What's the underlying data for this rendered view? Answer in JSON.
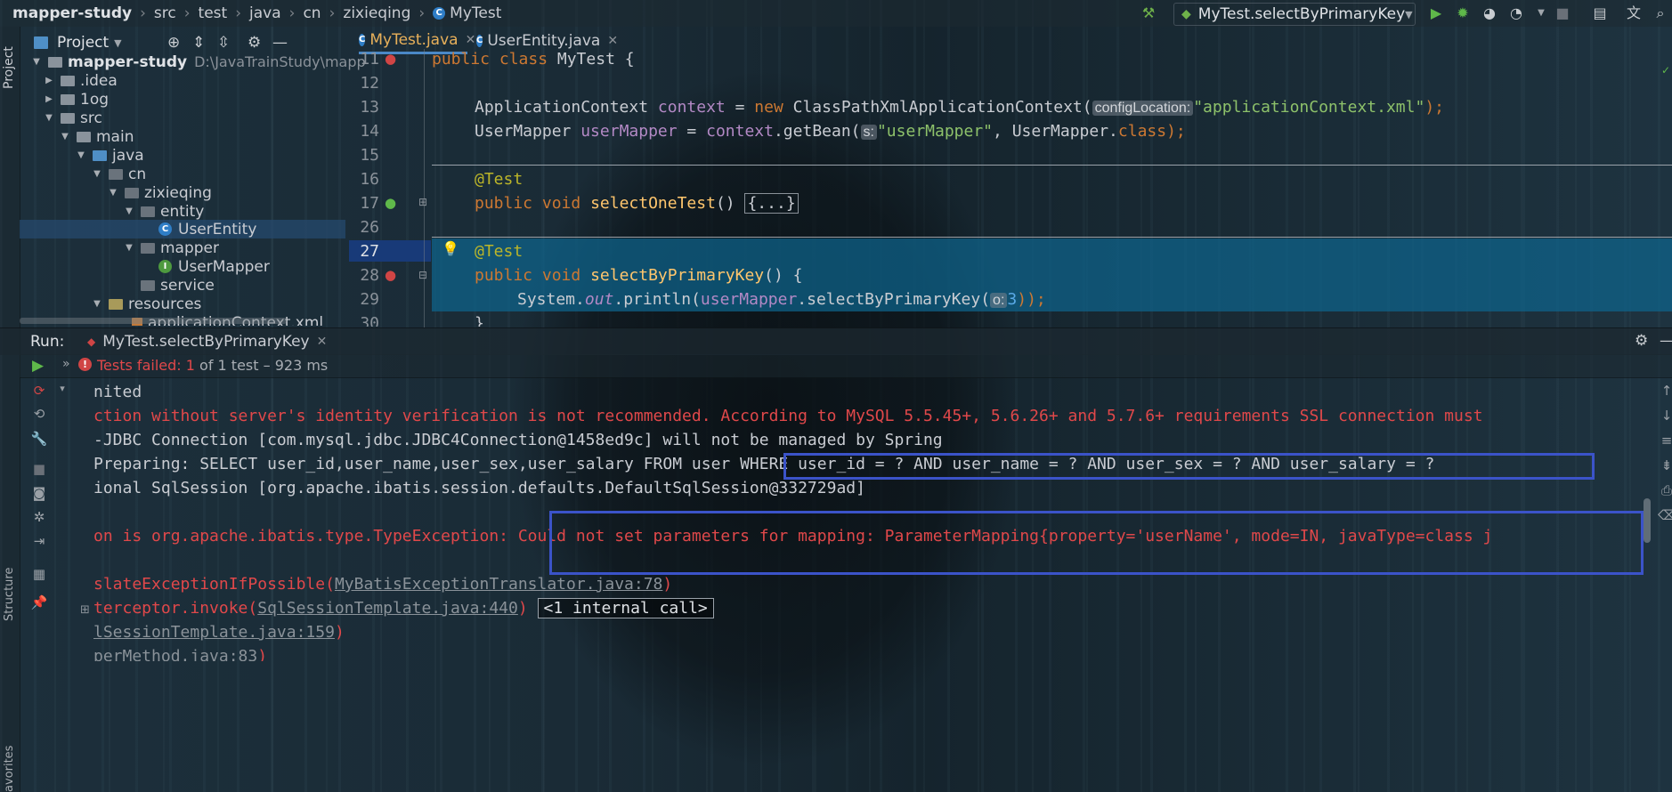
{
  "breadcrumbs": [
    "mapper-study",
    "src",
    "test",
    "java",
    "cn",
    "zixieqing",
    "MyTest"
  ],
  "run_config": "MyTest.selectByPrimaryKey",
  "project_panel": {
    "title": "Project",
    "tool_tab": "Project",
    "tree": [
      {
        "label": "mapper-study",
        "path": "D:\\JavaTrainStudy\\mapp"
      },
      {
        "label": ".idea"
      },
      {
        "label": "1og"
      },
      {
        "label": "src"
      },
      {
        "label": "main"
      },
      {
        "label": "java"
      },
      {
        "label": "cn"
      },
      {
        "label": "zixieqing"
      },
      {
        "label": "entity"
      },
      {
        "label": "UserEntity"
      },
      {
        "label": "mapper"
      },
      {
        "label": "UserMapper"
      },
      {
        "label": "service"
      },
      {
        "label": "resources"
      },
      {
        "label": "applicationContext.xml"
      }
    ]
  },
  "editor": {
    "tabs": [
      {
        "label": "MyTest.java"
      },
      {
        "label": "UserEntity.java"
      }
    ],
    "line_numbers": [
      "11",
      "12",
      "13",
      "14",
      "15",
      "16",
      "17",
      "26",
      "27",
      "28",
      "29",
      "30"
    ],
    "code": {
      "l11_kw": "public class",
      "l11_name": " MyTest {",
      "l13_type": "ApplicationContext ",
      "l13_var": "context",
      "l13_eq": " = ",
      "l13_new": "new",
      "l13_cls": " ClassPathXmlApplicationContext(",
      "l13_hint": "configLocation:",
      "l13_str": "\"applicationContext.xml\"",
      "l13_end": ");",
      "l14_type": "UserMapper ",
      "l14_var": "userMapper",
      "l14_eq": " = ",
      "l14_ctx": "context",
      "l14_call": ".getBean(",
      "l14_hint": "s:",
      "l14_str": "\"userMapper\"",
      "l14_mid": ", UserMapper.",
      "l14_kw": "class",
      "l14_end": ");",
      "l16_ann": "@Test",
      "l17_kw": "public void",
      "l17_m": "selectOneTest",
      "l17_p": "() ",
      "l17_fold": "{...}",
      "l27_ann": "@Test",
      "l28_kw": "public void",
      "l28_m": "selectByPrimaryKey",
      "l28_p": "() {",
      "l29_a": "System.",
      "l29_out": "out",
      "l29_b": ".println(",
      "l29_var": "userMapper",
      "l29_c": ".selectByPrimaryKey(",
      "l29_hint": "o:",
      "l29_num": "3",
      "l29_end": "));",
      "l30": "}"
    }
  },
  "run_panel": {
    "label": "Run:",
    "tab": "MyTest.selectByPrimaryKey",
    "status_prefix": "Tests failed:",
    "status_count": "1",
    "status_rest": "of 1 test – 923 ms"
  },
  "console": {
    "l1": "nited",
    "l2": "ction without server's identity verification is not recommended. According to MySQL 5.5.45+, 5.6.26+ and 5.7.6+ requirements SSL connection must",
    "l3": "-JDBC Connection [com.mysql.jdbc.JDBC4Connection@1458ed9c] will not be managed by Spring",
    "l4": "Preparing: SELECT user_id,user_name,user_sex,user_salary FROM user WHERE user_id = ? AND user_name = ? AND user_sex = ? AND user_salary = ?",
    "l5": "ional SqlSession [org.apache.ibatis.session.defaults.DefaultSqlSession@332729ad]",
    "l6": "on is org.apache.ibatis.type.TypeException: Could not set parameters for mapping: ParameterMapping{property='userName', mode=IN, javaType=class j",
    "l7_a": "slateExceptionIfPossible(",
    "l7_link": "MyBatisExceptionTranslator.java:78",
    "l7_b": ")",
    "l8_a": "terceptor.invoke(",
    "l8_link": "SqlSessionTemplate.java:440",
    "l8_b": ")",
    "l8_badge": "<1 internal call>",
    "l9_link": "lSessionTemplate.java:159",
    "l9_b": ")",
    "l10_link": "perMethod.java:83",
    "l10_b": ")"
  },
  "side_tabs": [
    "Structure",
    "avorites"
  ],
  "colors": {
    "error": "#e0484a",
    "selection": "#0e648c",
    "highlight_box": "#3b53c9"
  }
}
